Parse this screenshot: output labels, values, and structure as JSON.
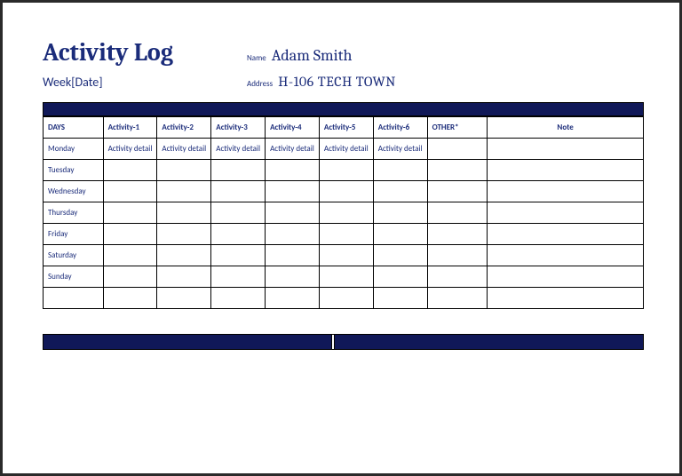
{
  "header": {
    "title": "Activity Log",
    "name_label": "Name",
    "name_value": "Adam Smith",
    "week_label": "Week[Date]",
    "address_label": "Address",
    "address_value": "H-106 TECH TOWN"
  },
  "columns": {
    "days": "DAYS",
    "act1": "Activity-1",
    "act2": "Activity-2",
    "act3": "Activity-3",
    "act4": "Activity-4",
    "act5": "Activity-5",
    "act6": "Activity-6",
    "other": "OTHER*",
    "note": "Note"
  },
  "days": {
    "mon": "Monday",
    "tue": "Tuesday",
    "wed": "Wednesday",
    "thu": "Thursday",
    "fri": "Friday",
    "sat": "Saturday",
    "sun": "Sunday"
  },
  "detail_placeholder": "Activity detail"
}
